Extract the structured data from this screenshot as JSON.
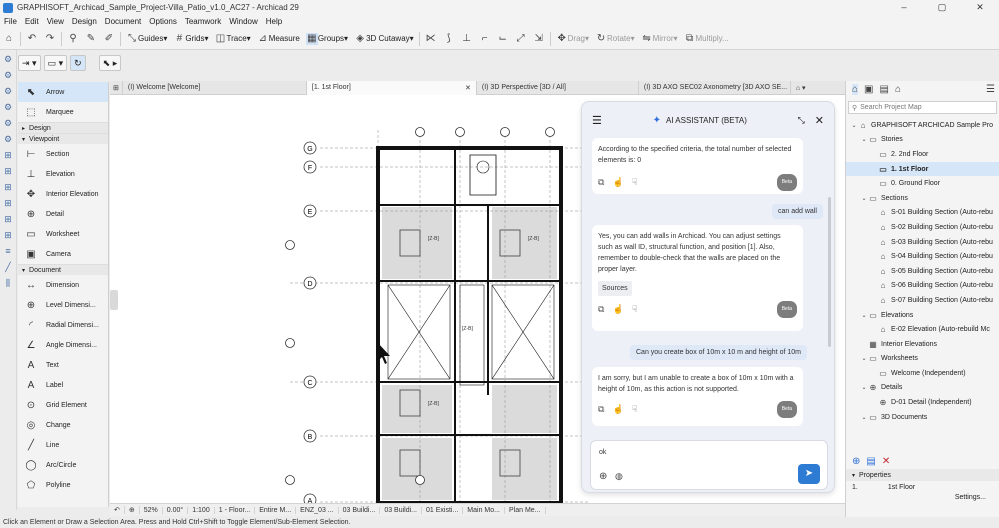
{
  "window": {
    "title": "GRAPHISOFT_Archicad_Sample_Project-Villa_Patio_v1.0_AC27 - Archicad 29",
    "controls": [
      "–",
      "▢",
      "✕"
    ]
  },
  "menu": [
    "File",
    "Edit",
    "View",
    "Design",
    "Document",
    "Options",
    "Teamwork",
    "Window",
    "Help"
  ],
  "toolbar": {
    "guides": "Guides",
    "grids": "Grids",
    "trace": "Trace",
    "measure": "Measure",
    "groups": "Groups",
    "cutaway": "3D Cutaway",
    "drag": "Drag",
    "rotate": "Rotate",
    "mirror": "Mirror",
    "multiply": "Multiply..."
  },
  "toolbox": {
    "items": [
      {
        "type": "tool",
        "label": "Arrow",
        "icon": "arrow-icon",
        "glyph": "⬉",
        "selected": true
      },
      {
        "type": "tool",
        "label": "Marquee",
        "icon": "marquee-icon",
        "glyph": "⬚"
      },
      {
        "type": "group",
        "label": "Design",
        "open": false
      },
      {
        "type": "group",
        "label": "Viewpoint",
        "open": true
      },
      {
        "type": "tool",
        "label": "Section",
        "icon": "section-icon",
        "glyph": "⊢"
      },
      {
        "type": "tool",
        "label": "Elevation",
        "icon": "elevation-icon",
        "glyph": "⊥"
      },
      {
        "type": "tool",
        "label": "Interior Elevation",
        "icon": "interior-elevation-icon",
        "glyph": "✥"
      },
      {
        "type": "tool",
        "label": "Detail",
        "icon": "detail-icon",
        "glyph": "⊕"
      },
      {
        "type": "tool",
        "label": "Worksheet",
        "icon": "worksheet-icon",
        "glyph": "▭"
      },
      {
        "type": "tool",
        "label": "Camera",
        "icon": "camera-icon",
        "glyph": "▣"
      },
      {
        "type": "group",
        "label": "Document",
        "open": true
      },
      {
        "type": "tool",
        "label": "Dimension",
        "icon": "dimension-icon",
        "glyph": "↔"
      },
      {
        "type": "tool",
        "label": "Level Dimensi...",
        "icon": "level-dimension-icon",
        "glyph": "⊕"
      },
      {
        "type": "tool",
        "label": "Radial Dimensi...",
        "icon": "radial-dimension-icon",
        "glyph": "◜"
      },
      {
        "type": "tool",
        "label": "Angle Dimensi...",
        "icon": "angle-dimension-icon",
        "glyph": "∠"
      },
      {
        "type": "tool",
        "label": "Text",
        "icon": "text-icon",
        "glyph": "A"
      },
      {
        "type": "tool",
        "label": "Label",
        "icon": "label-icon",
        "glyph": "A"
      },
      {
        "type": "tool",
        "label": "Grid Element",
        "icon": "grid-element-icon",
        "glyph": "⊙"
      },
      {
        "type": "tool",
        "label": "Change",
        "icon": "change-icon",
        "glyph": "◎"
      },
      {
        "type": "tool",
        "label": "Line",
        "icon": "line-icon",
        "glyph": "╱"
      },
      {
        "type": "tool",
        "label": "Arc/Circle",
        "icon": "arc-circle-icon",
        "glyph": "◯"
      },
      {
        "type": "tool",
        "label": "Polyline",
        "icon": "polyline-icon",
        "glyph": "⬠"
      }
    ]
  },
  "tabs": [
    {
      "label": "(I) Welcome [Welcome]",
      "active": false
    },
    {
      "label": "[1. 1st Floor]",
      "active": true
    },
    {
      "label": "(I) 3D Perspective [3D / All]",
      "active": false
    },
    {
      "label": "(I) 3D AXO SEC02 Axonometry [3D AXO SE...",
      "active": false
    }
  ],
  "plan": {
    "grid_rows": [
      "G",
      "F",
      "E",
      "D",
      "C",
      "B",
      "A"
    ],
    "tags": [
      "[Z-B]",
      "[Z-B]",
      "[Z-B]",
      "[Z-B]"
    ]
  },
  "chat": {
    "title": "AI ASSISTANT (BETA)",
    "messages": [
      {
        "role": "assistant",
        "text": "According to the specified criteria, the total number of selected elements is: 0",
        "beta": "Beta"
      },
      {
        "role": "user",
        "text": "can add wall"
      },
      {
        "role": "assistant",
        "text": "Yes, you can add walls in Archicad. You can adjust settings such as wall ID, structural function, and position [1]. Also, remember to double-check that the walls are placed on the proper layer.",
        "sources": "Sources",
        "beta": "Beta"
      },
      {
        "role": "user",
        "text": "Can you create box of 10m x 10 m and height of 10m"
      },
      {
        "role": "assistant",
        "text": "I am sorry, but I am unable to create a box of 10m x 10m with a height of 10m, as this action is not supported.",
        "beta": "Beta"
      }
    ],
    "input_value": "ok"
  },
  "navigator": {
    "search_placeholder": "Search Project Map",
    "tree": [
      {
        "label": "GRAPHISOFT ARCHICAD Sample Pro",
        "level": 0,
        "arrow": "⌄",
        "icon": "project-icon",
        "glyph": "⌂"
      },
      {
        "label": "Stories",
        "level": 1,
        "arrow": "⌄",
        "icon": "folder-icon",
        "glyph": "▭"
      },
      {
        "label": "2. 2nd Floor",
        "level": 2,
        "icon": "story-icon",
        "glyph": "▭"
      },
      {
        "label": "1. 1st Floor",
        "level": 2,
        "icon": "story-icon",
        "glyph": "▭",
        "selected": true
      },
      {
        "label": "0. Ground Floor",
        "level": 2,
        "icon": "story-icon",
        "glyph": "▭"
      },
      {
        "label": "Sections",
        "level": 1,
        "arrow": "⌄",
        "icon": "folder-icon",
        "glyph": "▭"
      },
      {
        "label": "S-01 Building Section (Auto-rebu",
        "level": 2,
        "icon": "section-view-icon",
        "glyph": "⌂"
      },
      {
        "label": "S-02 Building Section (Auto-rebu",
        "level": 2,
        "icon": "section-view-icon",
        "glyph": "⌂"
      },
      {
        "label": "S-03 Building Section (Auto-rebu",
        "level": 2,
        "icon": "section-view-icon",
        "glyph": "⌂"
      },
      {
        "label": "S-04 Building Section (Auto-rebu",
        "level": 2,
        "icon": "section-view-icon",
        "glyph": "⌂"
      },
      {
        "label": "S-05 Building Section (Auto-rebu",
        "level": 2,
        "icon": "section-view-icon",
        "glyph": "⌂"
      },
      {
        "label": "S-06 Building Section (Auto-rebu",
        "level": 2,
        "icon": "section-view-icon",
        "glyph": "⌂"
      },
      {
        "label": "S-07 Building Section (Auto-rebu",
        "level": 2,
        "icon": "section-view-icon",
        "glyph": "⌂"
      },
      {
        "label": "Elevations",
        "level": 1,
        "arrow": "⌄",
        "icon": "folder-icon",
        "glyph": "▭"
      },
      {
        "label": "E-02 Elevation (Auto-rebuild Mc",
        "level": 2,
        "icon": "elevation-view-icon",
        "glyph": "⌂"
      },
      {
        "label": "Interior Elevations",
        "level": 1,
        "icon": "interior-elevations-icon",
        "glyph": "▦"
      },
      {
        "label": "Worksheets",
        "level": 1,
        "arrow": "⌄",
        "icon": "worksheets-icon",
        "glyph": "▭"
      },
      {
        "label": "Welcome (Independent)",
        "level": 2,
        "icon": "worksheet-view-icon",
        "glyph": "▭"
      },
      {
        "label": "Details",
        "level": 1,
        "arrow": "⌄",
        "icon": "details-icon",
        "glyph": "⊕"
      },
      {
        "label": "D-01 Detail (Independent)",
        "level": 2,
        "icon": "detail-view-icon",
        "glyph": "⊕"
      },
      {
        "label": "3D Documents",
        "level": 1,
        "arrow": "⌄",
        "icon": "3d-documents-icon",
        "glyph": "▭"
      }
    ],
    "properties_title": "Properties",
    "properties_id": "1.",
    "properties_value": "1st Floor",
    "settings_label": "Settings..."
  },
  "statusbar": {
    "zoom": "52%",
    "angle": "0.00°",
    "scale": "1:100",
    "items": [
      "1 - Floor...",
      "Entire M...",
      "ENZ_03 ...",
      "03 Buildi...",
      "03 Buildi...",
      "01 Existi...",
      "Main Mo...",
      "Plan Me..."
    ]
  },
  "hint": "Click an Element or Draw a Selection Area. Press and Hold Ctrl+Shift to Toggle Element/Sub-Element Selection."
}
